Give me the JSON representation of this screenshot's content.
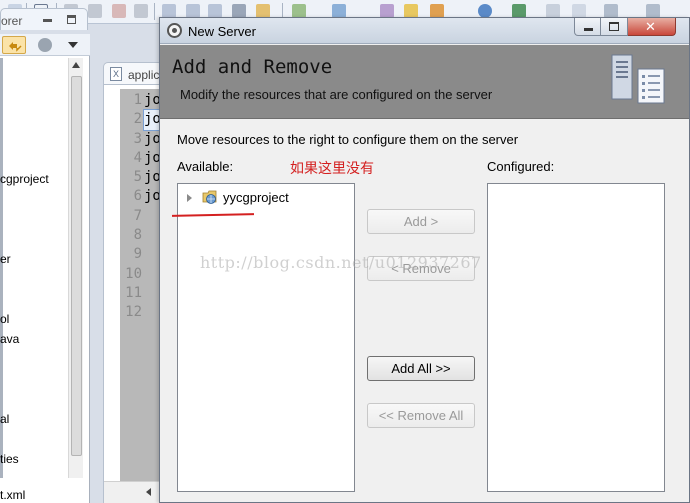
{
  "ide": {
    "left_view": {
      "tab_label": "orer",
      "tree_items": [
        "cgproject",
        "er",
        "ol",
        "ava",
        "al",
        "ties",
        "t.xml"
      ]
    },
    "editor": {
      "tab_label": "applic",
      "file_icon_letter": "X",
      "line_numbers": [
        "1",
        "2",
        "3",
        "4",
        "5",
        "6",
        "7",
        "8",
        "9",
        "10",
        "11",
        "12"
      ],
      "code_lines": [
        "jo",
        "jo",
        "jo",
        "jo",
        "jo",
        "jo"
      ]
    }
  },
  "dialog": {
    "title": "New Server",
    "window_controls": {
      "close_glyph": "✕"
    },
    "banner": {
      "title": "Add and Remove",
      "description": "Modify the resources that are configured on the server"
    },
    "instruction": "Move resources to the right to configure them on the server",
    "available": {
      "label": "Available:",
      "items": [
        {
          "name": "yycgproject",
          "icon": "web-project-icon"
        }
      ]
    },
    "configured": {
      "label": "Configured:",
      "items": []
    },
    "buttons": {
      "add": "Add >",
      "remove": "< Remove",
      "add_all": "Add All >>",
      "remove_all": "<< Remove All"
    },
    "annotation": "如果这里没有",
    "watermark": "http://blog.csdn.net/u012937267"
  },
  "colors": {
    "annotation_red": "#d42020",
    "banner_gray": "#8a8a8a",
    "title_bar": "#c9d3e0"
  }
}
